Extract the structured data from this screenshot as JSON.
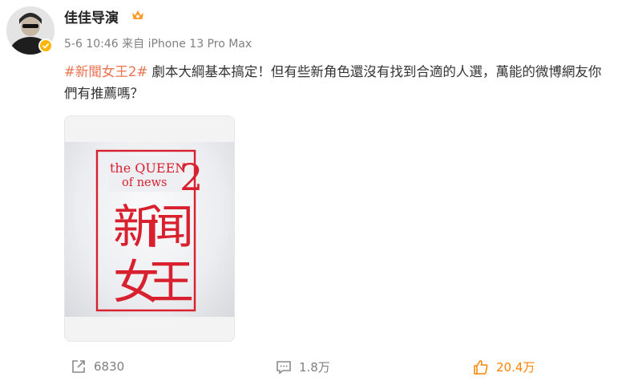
{
  "post": {
    "author": "佳佳导演",
    "date": "5-6 10:46",
    "source_prefix": "来自",
    "source_device": "iPhone 13 Pro Max",
    "hashtag": "#新聞女王2#",
    "text": " 劇本大綱基本搞定！但有些新角色還沒有找到合適的人選，萬能的微博網友你們有推薦嗎？"
  },
  "poster": {
    "title_en_line1": "the QUEEN",
    "title_en_line2": "of news",
    "number": "2",
    "chars": [
      "新",
      "闻",
      "女",
      "王"
    ],
    "accent_color": "#d8202f"
  },
  "actions": {
    "repost_count": "6830",
    "comment_count": "1.8万",
    "like_count": "20.4万"
  },
  "colors": {
    "hashtag": "#eb7350",
    "like": "#ff8200",
    "verified": "#ffb400"
  }
}
